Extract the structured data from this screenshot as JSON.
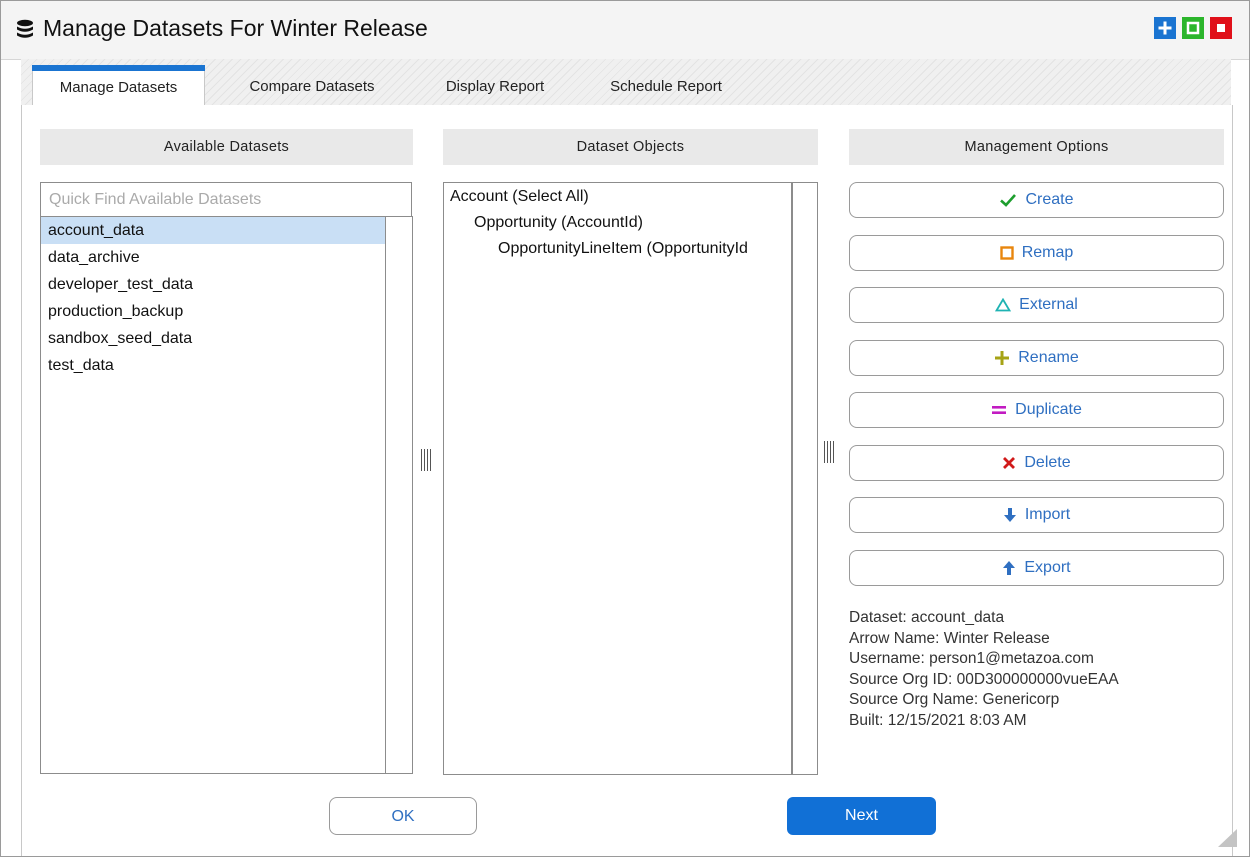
{
  "window": {
    "title": "Manage Datasets For Winter Release",
    "title_icon": "database-icon",
    "controls": [
      {
        "name": "add-icon",
        "color": "#1a74d1"
      },
      {
        "name": "maximize-icon",
        "color": "#2bb52b"
      },
      {
        "name": "close-icon",
        "color": "#e0101a"
      }
    ]
  },
  "tabs": [
    {
      "label": "Manage Datasets",
      "active": true
    },
    {
      "label": "Compare Datasets",
      "active": false
    },
    {
      "label": "Display Report",
      "active": false
    },
    {
      "label": "Schedule Report",
      "active": false
    }
  ],
  "available": {
    "header": "Available Datasets",
    "search_placeholder": "Quick Find Available Datasets",
    "items": [
      "account_data",
      "data_archive",
      "developer_test_data",
      "production_backup",
      "sandbox_seed_data",
      "test_data"
    ],
    "selected": "account_data"
  },
  "objects": {
    "header": "Dataset Objects",
    "items": [
      {
        "label": "Account (Select All)",
        "depth": 0
      },
      {
        "label": "Opportunity (AccountId)",
        "depth": 1
      },
      {
        "label": "OpportunityLineItem (OpportunityId",
        "depth": 2
      }
    ]
  },
  "management": {
    "header": "Management Options",
    "buttons": [
      {
        "label": "Create",
        "icon": "check-icon",
        "color": "#1e9e2e"
      },
      {
        "label": "Remap",
        "icon": "square-outline-icon",
        "color": "#e8860d"
      },
      {
        "label": "External",
        "icon": "triangle-outline-icon",
        "color": "#1fb3b3"
      },
      {
        "label": "Rename",
        "icon": "plus-icon",
        "color": "#a6a315"
      },
      {
        "label": "Duplicate",
        "icon": "equals-icon",
        "color": "#c21bc2"
      },
      {
        "label": "Delete",
        "icon": "x-icon",
        "color": "#d11a1a"
      },
      {
        "label": "Import",
        "icon": "arrow-down-icon",
        "color": "#2f6fc1"
      },
      {
        "label": "Export",
        "icon": "arrow-up-icon",
        "color": "#2f6fc1"
      }
    ],
    "info": [
      "Dataset: account_data",
      "Arrow Name: Winter Release",
      "Username: person1@metazoa.com",
      "Source Org ID: 00D300000000vueEAA",
      "Source Org Name: Genericorp",
      "Built: 12/15/2021 8:03 AM"
    ]
  },
  "footer": {
    "ok_label": "OK",
    "next_label": "Next"
  }
}
